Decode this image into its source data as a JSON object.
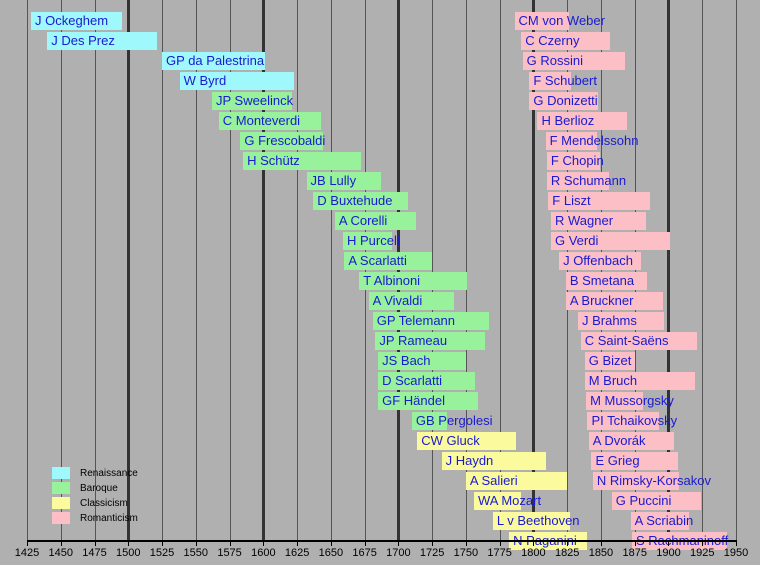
{
  "chart_data": {
    "type": "bar",
    "title": "",
    "subtitle": "",
    "xlabel": "",
    "ylabel": "",
    "xlim": [
      1425,
      1950
    ],
    "tick_step": 25,
    "major_tick_step": 100,
    "grid": true,
    "orientation": "horizontal-gantt",
    "tick_labels": [
      "1425",
      "1450",
      "1475",
      "1500",
      "1525",
      "1550",
      "1575",
      "1600",
      "1625",
      "1650",
      "1675",
      "1700",
      "1725",
      "1750",
      "1775",
      "1800",
      "1825",
      "1850",
      "1875",
      "1900",
      "1925",
      "1950"
    ],
    "legend_position": "bottom-left",
    "legend": [
      {
        "label": "Renaissance",
        "color": "#9ff8fb"
      },
      {
        "label": "Baroque",
        "color": "#97f29b"
      },
      {
        "label": "Classicism",
        "color": "#fbfb9d"
      },
      {
        "label": "Romanticism",
        "color": "#fbbfc5"
      }
    ],
    "colors": {
      "background": "#b0b0b0",
      "gridline": "#555555",
      "gridline_major": "#333333",
      "label_text": "#1a1ad0",
      "axis_text": "#000000"
    },
    "series": [
      {
        "name": "J Ockeghem",
        "era": "Renaissance",
        "start": 1428,
        "end": 1495,
        "column": "left",
        "row": 0
      },
      {
        "name": "J Des Prez",
        "era": "Renaissance",
        "start": 1440,
        "end": 1521,
        "column": "left",
        "row": 1
      },
      {
        "name": "GP da Palestrina",
        "era": "Renaissance",
        "start": 1525,
        "end": 1601,
        "column": "left",
        "row": 2
      },
      {
        "name": "W Byrd",
        "era": "Renaissance",
        "start": 1538,
        "end": 1623,
        "column": "left",
        "row": 3
      },
      {
        "name": "JP Sweelinck",
        "era": "Baroque",
        "start": 1562,
        "end": 1621,
        "column": "left",
        "row": 4
      },
      {
        "name": "C Monteverdi",
        "era": "Baroque",
        "start": 1567,
        "end": 1643,
        "column": "left",
        "row": 5
      },
      {
        "name": "G Frescobaldi",
        "era": "Baroque",
        "start": 1583,
        "end": 1644,
        "column": "left",
        "row": 6
      },
      {
        "name": "H Schütz",
        "era": "Baroque",
        "start": 1585,
        "end": 1672,
        "column": "left",
        "row": 7
      },
      {
        "name": "JB Lully",
        "era": "Baroque",
        "start": 1632,
        "end": 1687,
        "column": "left",
        "row": 8
      },
      {
        "name": "D Buxtehude",
        "era": "Baroque",
        "start": 1637,
        "end": 1707,
        "column": "left",
        "row": 9
      },
      {
        "name": "A Corelli",
        "era": "Baroque",
        "start": 1653,
        "end": 1713,
        "column": "left",
        "row": 10
      },
      {
        "name": "H Purcell",
        "era": "Baroque",
        "start": 1659,
        "end": 1695,
        "column": "left",
        "row": 11
      },
      {
        "name": "A Scarlatti",
        "era": "Baroque",
        "start": 1660,
        "end": 1725,
        "column": "left",
        "row": 12
      },
      {
        "name": "T Albinoni",
        "era": "Baroque",
        "start": 1671,
        "end": 1751,
        "column": "left",
        "row": 13
      },
      {
        "name": "A Vivaldi",
        "era": "Baroque",
        "start": 1678,
        "end": 1741,
        "column": "left",
        "row": 14
      },
      {
        "name": "GP Telemann",
        "era": "Baroque",
        "start": 1681,
        "end": 1767,
        "column": "left",
        "row": 15
      },
      {
        "name": "JP Rameau",
        "era": "Baroque",
        "start": 1683,
        "end": 1764,
        "column": "left",
        "row": 16
      },
      {
        "name": "JS Bach",
        "era": "Baroque",
        "start": 1685,
        "end": 1750,
        "column": "left",
        "row": 17
      },
      {
        "name": "D Scarlatti",
        "era": "Baroque",
        "start": 1685,
        "end": 1757,
        "column": "left",
        "row": 18
      },
      {
        "name": "GF Händel",
        "era": "Baroque",
        "start": 1685,
        "end": 1759,
        "column": "left",
        "row": 19
      },
      {
        "name": "GB Pergolesi",
        "era": "Baroque",
        "start": 1710,
        "end": 1736,
        "column": "left",
        "row": 20
      },
      {
        "name": "CW Gluck",
        "era": "Classicism",
        "start": 1714,
        "end": 1787,
        "column": "left",
        "row": 21
      },
      {
        "name": "J Haydn",
        "era": "Classicism",
        "start": 1732,
        "end": 1809,
        "column": "left",
        "row": 22
      },
      {
        "name": "A Salieri",
        "era": "Classicism",
        "start": 1750,
        "end": 1825,
        "column": "left",
        "row": 23
      },
      {
        "name": "WA Mozart",
        "era": "Classicism",
        "start": 1756,
        "end": 1791,
        "column": "left",
        "row": 24
      },
      {
        "name": "L v Beethoven",
        "era": "Classicism",
        "start": 1770,
        "end": 1827,
        "column": "left",
        "row": 25
      },
      {
        "name": "N Paganini",
        "era": "Classicism",
        "start": 1782,
        "end": 1840,
        "column": "left",
        "row": 26
      },
      {
        "name": "CM von Weber",
        "era": "Romanticism",
        "start": 1786,
        "end": 1826,
        "column": "right",
        "row": 0
      },
      {
        "name": "C Czerny",
        "era": "Romanticism",
        "start": 1791,
        "end": 1857,
        "column": "right",
        "row": 1
      },
      {
        "name": "G Rossini",
        "era": "Romanticism",
        "start": 1792,
        "end": 1868,
        "column": "right",
        "row": 2
      },
      {
        "name": "F Schubert",
        "era": "Romanticism",
        "start": 1797,
        "end": 1828,
        "column": "right",
        "row": 3
      },
      {
        "name": "G Donizetti",
        "era": "Romanticism",
        "start": 1797,
        "end": 1848,
        "column": "right",
        "row": 4
      },
      {
        "name": "H Berlioz",
        "era": "Romanticism",
        "start": 1803,
        "end": 1869,
        "column": "right",
        "row": 5
      },
      {
        "name": "F Mendelssohn",
        "era": "Romanticism",
        "start": 1809,
        "end": 1847,
        "column": "right",
        "row": 6
      },
      {
        "name": "F Chopin",
        "era": "Romanticism",
        "start": 1810,
        "end": 1849,
        "column": "right",
        "row": 7
      },
      {
        "name": "R Schumann",
        "era": "Romanticism",
        "start": 1810,
        "end": 1856,
        "column": "right",
        "row": 8
      },
      {
        "name": "F Liszt",
        "era": "Romanticism",
        "start": 1811,
        "end": 1886,
        "column": "right",
        "row": 9
      },
      {
        "name": "R Wagner",
        "era": "Romanticism",
        "start": 1813,
        "end": 1883,
        "column": "right",
        "row": 10
      },
      {
        "name": "G Verdi",
        "era": "Romanticism",
        "start": 1813,
        "end": 1901,
        "column": "right",
        "row": 11
      },
      {
        "name": "J Offenbach",
        "era": "Romanticism",
        "start": 1819,
        "end": 1880,
        "column": "right",
        "row": 12
      },
      {
        "name": "B Smetana",
        "era": "Romanticism",
        "start": 1824,
        "end": 1884,
        "column": "right",
        "row": 13
      },
      {
        "name": "A Bruckner",
        "era": "Romanticism",
        "start": 1824,
        "end": 1896,
        "column": "right",
        "row": 14
      },
      {
        "name": "J Brahms",
        "era": "Romanticism",
        "start": 1833,
        "end": 1897,
        "column": "right",
        "row": 15
      },
      {
        "name": "C Saint-Saëns",
        "era": "Romanticism",
        "start": 1835,
        "end": 1921,
        "column": "right",
        "row": 16
      },
      {
        "name": "G Bizet",
        "era": "Romanticism",
        "start": 1838,
        "end": 1875,
        "column": "right",
        "row": 17
      },
      {
        "name": "M Bruch",
        "era": "Romanticism",
        "start": 1838,
        "end": 1920,
        "column": "right",
        "row": 18
      },
      {
        "name": "M Mussorgsky",
        "era": "Romanticism",
        "start": 1839,
        "end": 1881,
        "column": "right",
        "row": 19
      },
      {
        "name": "PI Tchaikovsky",
        "era": "Romanticism",
        "start": 1840,
        "end": 1893,
        "column": "right",
        "row": 20
      },
      {
        "name": "A Dvorák",
        "era": "Romanticism",
        "start": 1841,
        "end": 1904,
        "column": "right",
        "row": 21
      },
      {
        "name": "E Grieg",
        "era": "Romanticism",
        "start": 1843,
        "end": 1907,
        "column": "right",
        "row": 22
      },
      {
        "name": "N Rimsky-Korsakov",
        "era": "Romanticism",
        "start": 1844,
        "end": 1908,
        "column": "right",
        "row": 23
      },
      {
        "name": "G Puccini",
        "era": "Romanticism",
        "start": 1858,
        "end": 1924,
        "column": "right",
        "row": 24
      },
      {
        "name": "A Scriabin",
        "era": "Romanticism",
        "start": 1872,
        "end": 1915,
        "column": "right",
        "row": 25
      },
      {
        "name": "S Rachmaninoff",
        "era": "Romanticism",
        "start": 1873,
        "end": 1943,
        "column": "right",
        "row": 26
      }
    ]
  }
}
